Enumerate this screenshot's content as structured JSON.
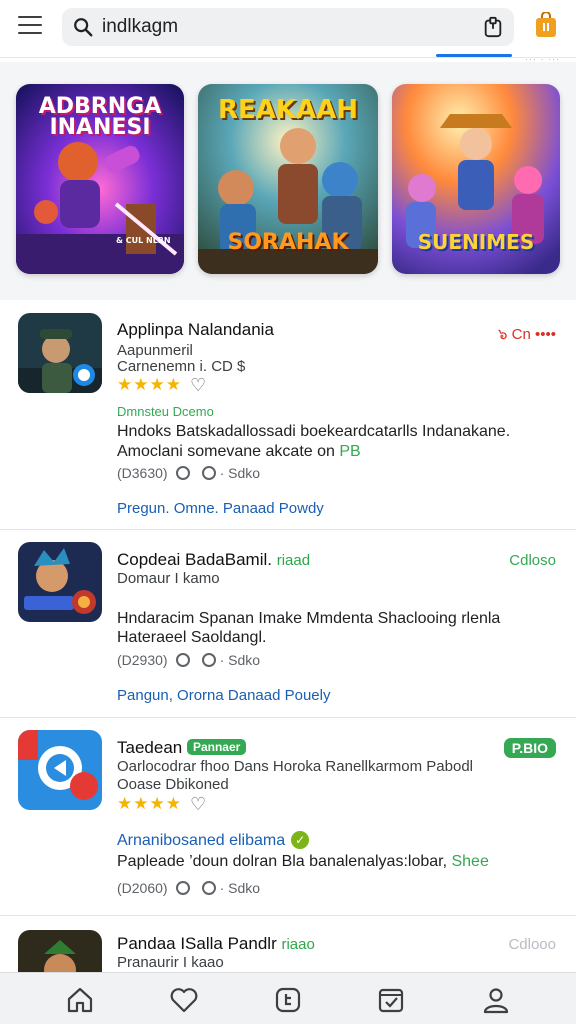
{
  "search": {
    "value": "indlkagm"
  },
  "header_hint": "··· · ···",
  "banners": [
    {
      "title": "ADBRNGA INANESI",
      "subtitle": "& CUL NLBN",
      "theme": "purple"
    },
    {
      "title": "REAKAAH",
      "subtitle": "SORAHAK",
      "theme": "teal"
    },
    {
      "title": "",
      "subtitle": "SUENIMES",
      "theme": "sunset"
    }
  ],
  "apps": [
    {
      "name": "Applinpa Nalandania",
      "developer": "Aapunmeril",
      "category": "Carnenemn i. CD $",
      "stars": "★★★★",
      "status": "๖ Cn ••••",
      "status_color": "#d93025",
      "note": "Dmnsteu Dcemo",
      "desc_line1": "Hndoks Batskadallossadi boekeardcatarlls Indanakane.",
      "desc_line2": "Amoclani somevane akcate on",
      "desc_tag": "PB",
      "meta_count": "(D3630)",
      "meta_tail": "· Sdko",
      "links": "Pregun. Omne. Panaad Powdy"
    },
    {
      "name": "Copdeai BadaBamil.",
      "name_tag": "riaad",
      "developer": "Domaur I kamo",
      "status": "Cdloso",
      "status_color": "#34a853",
      "desc_line1": "Hndaracim Spanan Imake Mmdenta Shaclooing rlenla",
      "desc_line2": "Hateraeel Saoldangl.",
      "meta_count": "(D2930)",
      "meta_tail": "· Sdko",
      "links": "Pangun, Ororna Danaad Pouely"
    },
    {
      "name": "Taedean",
      "pill": "Pannaer",
      "developer": "Oarlocodrar fhoo Dans Horoka Ranellkarmom Pabodl",
      "category": "Ooase Dbikoned",
      "stars": "★★★★",
      "status": "P.BIO",
      "sublink": "Arnanibosaned elibama",
      "desc_line1": "Papleade ’doun dolran Bla banalenalyas:lobar,",
      "desc_tag": "Shee",
      "meta_count": "(D2060)",
      "meta_tail": "· Sdko"
    },
    {
      "name": "Pandaa ISalla Pandlr",
      "name_tag": "riaao",
      "developer": "Pranaurir I kaao",
      "status": "Cdlooo",
      "status_color": "#b8bcc2"
    }
  ],
  "colors": {
    "accent": "#1a73e8",
    "rating": "#f4b400",
    "positive": "#34a853",
    "alert": "#d93025",
    "link": "#1a5fb4"
  },
  "icons": [
    "menu-icon",
    "search-icon",
    "clipboard-icon",
    "shopping-bag-icon",
    "home-icon",
    "heart-icon",
    "apps-icon",
    "calendar-check-icon",
    "profile-icon"
  ]
}
